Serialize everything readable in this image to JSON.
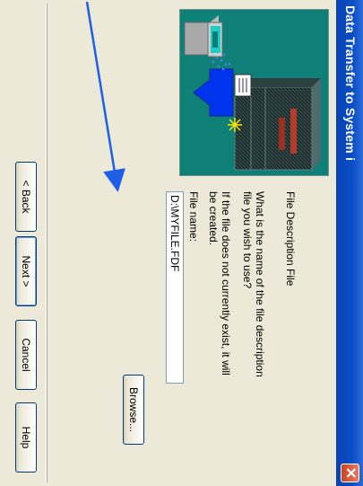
{
  "window": {
    "title": "Data Transfer to System i",
    "close_glyph": "✕"
  },
  "page": {
    "heading": "File Description File",
    "question": "What is the name of the file description file you wish to use?",
    "note": "If the file does not currently exist, it will be created.",
    "file_name_label": "File name:",
    "file_name_value": "D:\\MYFILE.FDF"
  },
  "buttons": {
    "browse": "Browse...",
    "back": "< Back",
    "next": "Next >",
    "cancel": "Cancel",
    "help": "Help"
  },
  "colors": {
    "titlebar": "#0a4ec6",
    "dialog_bg": "#ece9d8",
    "annotation_arrow": "#1f5fe8"
  }
}
